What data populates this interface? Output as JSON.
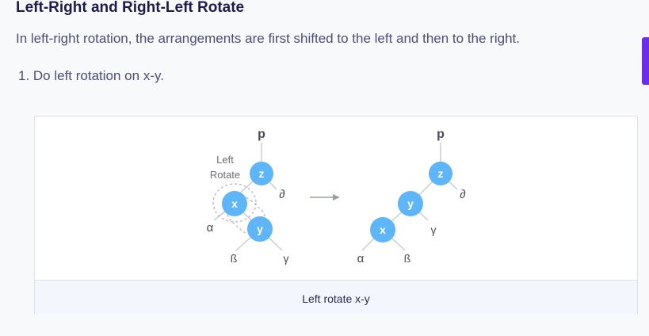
{
  "heading": "Left-Right and Right-Left Rotate",
  "intro": "In left-right rotation, the arrangements are first shifted to the left and then to the right.",
  "step": "1. Do left rotation on x-y.",
  "figure": {
    "caption": "Left rotate x-y",
    "before": {
      "annotation_line1": "Left",
      "annotation_line2": "Rotate",
      "parent_label": "p",
      "node_z": "z",
      "node_x": "x",
      "node_y": "y",
      "leaf_delta": "∂",
      "leaf_alpha": "α",
      "leaf_beta": "ß",
      "leaf_gamma": "γ"
    },
    "after": {
      "parent_label": "p",
      "node_z": "z",
      "node_y": "y",
      "node_x": "x",
      "leaf_delta": "∂",
      "leaf_gamma": "γ",
      "leaf_alpha": "α",
      "leaf_beta": "ß"
    },
    "colors": {
      "node_fill": "#5eb5f7",
      "node_text": "#ffffff",
      "edge": "#c9cdd6",
      "arrow": "#9a9ea8",
      "label": "#4a4a55"
    }
  }
}
